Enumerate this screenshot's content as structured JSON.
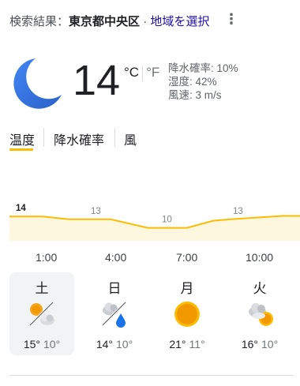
{
  "header": {
    "prefix": "検索結果：",
    "location": "東京都中央区",
    "dot": "·",
    "change_location": "地域を選択",
    "menu_icon": "more-vert-icon"
  },
  "current": {
    "condition_icon": "moon-icon",
    "temperature": "14",
    "unit_c": "°C",
    "unit_f": "°F",
    "precipitation": "降水確率: 10%",
    "humidity": "湿度: 42%",
    "wind": "風速: 3 m/s"
  },
  "tabs": [
    {
      "label": "温度",
      "active": true
    },
    {
      "label": "降水確率",
      "active": false
    },
    {
      "label": "風",
      "active": false
    }
  ],
  "colors": {
    "accent": "#fbbc04",
    "chart_fill": "#fef7e0",
    "sun": "#f29900",
    "rain": "#4285f4"
  },
  "chart_data": {
    "type": "area",
    "x": [
      "1:00",
      "4:00",
      "7:00",
      "10:00"
    ],
    "values": [
      14,
      13,
      10,
      13
    ],
    "labels": [
      "14",
      "13",
      "10",
      "13"
    ]
  },
  "forecast": [
    {
      "day": "土",
      "icon": "partly-cloudy-sun-icon",
      "high": "15°",
      "low": "10°",
      "selected": true
    },
    {
      "day": "日",
      "icon": "cloud-rain-icon",
      "high": "14°",
      "low": "10°",
      "selected": false
    },
    {
      "day": "月",
      "icon": "sun-icon",
      "high": "21°",
      "low": "11°",
      "selected": false
    },
    {
      "day": "火",
      "icon": "cloud-sun-icon",
      "high": "16°",
      "low": "10°",
      "selected": false
    }
  ]
}
